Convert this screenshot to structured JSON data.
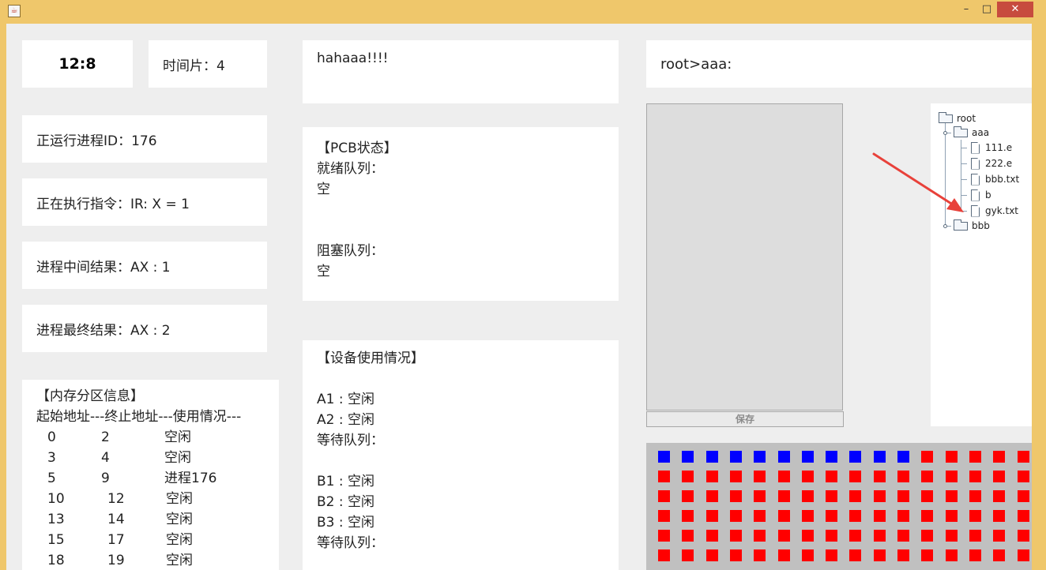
{
  "window": {
    "app_icon": "java-icon",
    "minimize_glyph": "–",
    "maximize_glyph": "□",
    "close_glyph": "✕"
  },
  "clock": "12:8",
  "time_slice": "时间片：4",
  "running_pid": "正运行进程ID：176",
  "current_instruction": "正在执行指令：IR: X = 1",
  "intermediate_result": "进程中间结果：AX : 1",
  "final_result": "进程最终结果：AX : 2",
  "memory": {
    "title": "【内存分区信息】",
    "header": "起始地址---终止地址---使用情况---",
    "rows": [
      {
        "start": "0",
        "end": "2",
        "state": "空闲"
      },
      {
        "start": "3",
        "end": "4",
        "state": "空闲"
      },
      {
        "start": "5",
        "end": "9",
        "state": "进程176"
      },
      {
        "start": "10",
        "end": "12",
        "state": "空闲"
      },
      {
        "start": "13",
        "end": "14",
        "state": "空闲"
      },
      {
        "start": "15",
        "end": "17",
        "state": "空闲"
      },
      {
        "start": "18",
        "end": "19",
        "state": "空闲"
      }
    ]
  },
  "output_text": "hahaaa!!!!",
  "pcb": {
    "title": "【PCB状态】",
    "ready_label": "就绪队列：",
    "ready_value": "空",
    "blocked_label": "阻塞队列：",
    "blocked_value": "空"
  },
  "devices": {
    "title": "【设备使用情况】",
    "a1": "A1 : 空闲",
    "a2": "A2 : 空闲",
    "a_wait": "等待队列：",
    "b1": "B1 : 空闲",
    "b2": "B2 : 空闲",
    "b3": "B3 : 空闲",
    "b_wait": "等待队列："
  },
  "path": "root>aaa:",
  "editor": {
    "save_label": "保存"
  },
  "tree": {
    "root": "root",
    "folder_aaa": "aaa",
    "files": [
      "111.e",
      "222.e",
      "bbb.txt",
      "b",
      "gyk.txt"
    ],
    "folder_bbb": "bbb"
  },
  "disk": {
    "columns": 16,
    "rows": 6,
    "used_count": 11,
    "used_color": "#0000ff",
    "free_color": "#ff0000"
  },
  "annotation": {
    "color": "#e8413a"
  }
}
